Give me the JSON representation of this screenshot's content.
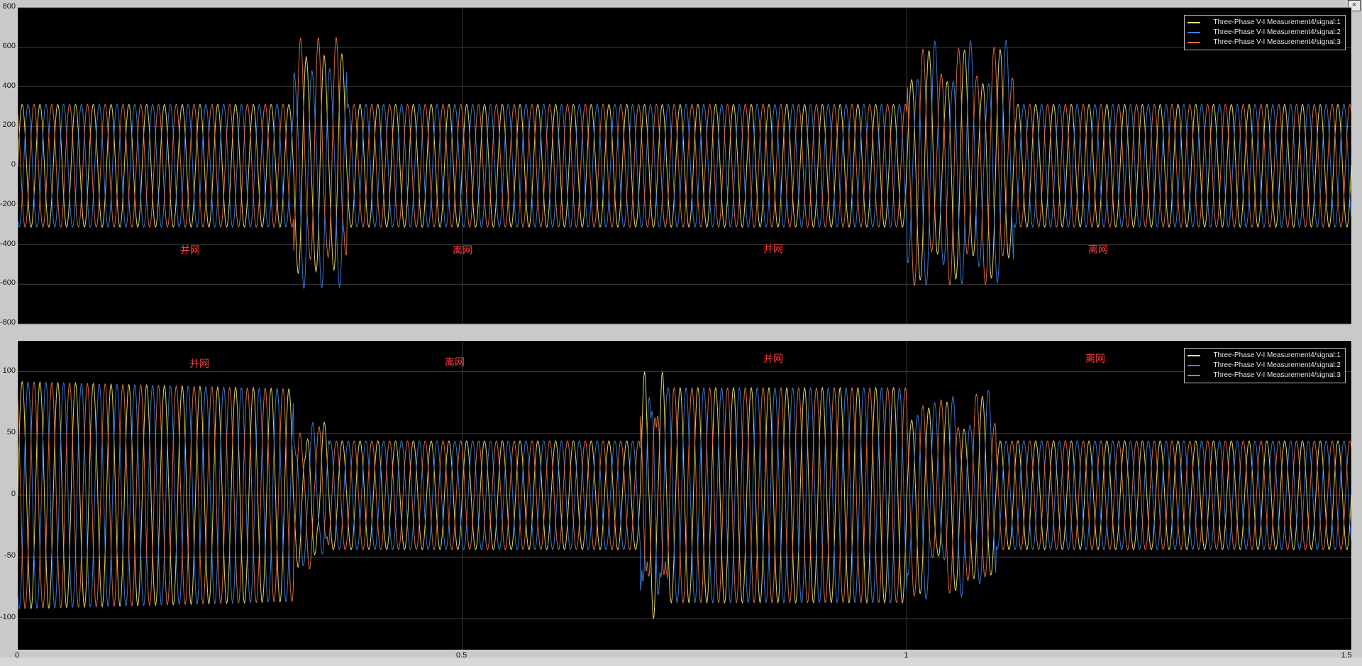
{
  "window": {
    "close_glyph": "×"
  },
  "colors": {
    "signal1": "#f2e36a",
    "signal2": "#3c7fe0",
    "signal3": "#e7723f",
    "annotation": "#ff3b3b",
    "grid": "#3f3f3f",
    "background": "#000000"
  },
  "legend_entries": [
    "Three-Phase V-I Measurement4/signal:1",
    "Three-Phase V-I Measurement4/signal:2",
    "Three-Phase V-I Measurement4/signal:3"
  ],
  "annotations_top": [
    "并网",
    "离网",
    "并网",
    "离网"
  ],
  "annotations_bottom": [
    "并网",
    "离网",
    "并网",
    "离网"
  ],
  "chart_data": [
    {
      "type": "line",
      "title": "",
      "xlabel": "",
      "ylabel": "",
      "xlim": [
        0,
        1.5
      ],
      "ylim": [
        -800,
        800
      ],
      "y_ticks": [
        "800",
        "600",
        "400",
        "200",
        "0",
        "-200",
        "-400",
        "-600",
        "-800"
      ],
      "x_ticks": [],
      "grid": true,
      "legend": "top-right",
      "series": [
        {
          "name": "Three-Phase V-I Measurement4/signal:1",
          "frequency_hz": 50,
          "phase_deg": 0,
          "segments": [
            {
              "from": 0,
              "to": 0.31,
              "amplitude": 311
            },
            {
              "from": 0.31,
              "to": 0.37,
              "amplitude": 620,
              "transient": true
            },
            {
              "from": 0.37,
              "to": 1.0,
              "amplitude": 311
            },
            {
              "from": 1.0,
              "to": 1.12,
              "amplitude": 600,
              "transient": true
            },
            {
              "from": 1.12,
              "to": 1.5,
              "amplitude": 311
            }
          ]
        },
        {
          "name": "Three-Phase V-I Measurement4/signal:2",
          "frequency_hz": 50,
          "phase_deg": -120,
          "segments": [
            {
              "from": 0,
              "to": 0.31,
              "amplitude": 311
            },
            {
              "from": 0.31,
              "to": 0.37,
              "amplitude": 640,
              "transient": true
            },
            {
              "from": 0.37,
              "to": 1.0,
              "amplitude": 311
            },
            {
              "from": 1.0,
              "to": 1.12,
              "amplitude": 640,
              "transient": true
            },
            {
              "from": 1.12,
              "to": 1.5,
              "amplitude": 311
            }
          ]
        },
        {
          "name": "Three-Phase V-I Measurement4/signal:3",
          "frequency_hz": 50,
          "phase_deg": 120,
          "segments": [
            {
              "from": 0,
              "to": 0.31,
              "amplitude": 311
            },
            {
              "from": 0.31,
              "to": 0.37,
              "amplitude": 660,
              "transient": true
            },
            {
              "from": 0.37,
              "to": 1.0,
              "amplitude": 311
            },
            {
              "from": 1.0,
              "to": 1.12,
              "amplitude": 620,
              "transient": true
            },
            {
              "from": 1.12,
              "to": 1.5,
              "amplitude": 311
            }
          ]
        }
      ]
    },
    {
      "type": "line",
      "title": "",
      "xlabel": "",
      "ylabel": "",
      "xlim": [
        0,
        1.5
      ],
      "ylim": [
        -125,
        125
      ],
      "y_ticks": [
        "100",
        "50",
        "0",
        "-50",
        "-100"
      ],
      "x_ticks": [
        "0",
        "0.5",
        "1",
        "1.5"
      ],
      "grid": true,
      "legend": "top-right",
      "series": [
        {
          "name": "Three-Phase V-I Measurement4/signal:1",
          "frequency_hz": 50,
          "phase_deg": 0,
          "segments": [
            {
              "from": 0,
              "to": 0.31,
              "amplitude": 92,
              "end_amplitude": 86
            },
            {
              "from": 0.31,
              "to": 0.35,
              "amplitude": 60,
              "transient": true
            },
            {
              "from": 0.35,
              "to": 0.7,
              "amplitude": 44
            },
            {
              "from": 0.7,
              "to": 0.73,
              "amplitude": 100,
              "transient": true
            },
            {
              "from": 0.73,
              "to": 1.0,
              "amplitude": 87
            },
            {
              "from": 1.0,
              "to": 1.1,
              "amplitude": 80,
              "transient": true
            },
            {
              "from": 1.1,
              "to": 1.5,
              "amplitude": 44
            }
          ]
        },
        {
          "name": "Three-Phase V-I Measurement4/signal:2",
          "frequency_hz": 50,
          "phase_deg": -120,
          "segments": [
            {
              "from": 0,
              "to": 0.31,
              "amplitude": 92,
              "end_amplitude": 86
            },
            {
              "from": 0.31,
              "to": 0.35,
              "amplitude": 60,
              "transient": true
            },
            {
              "from": 0.35,
              "to": 0.7,
              "amplitude": 44
            },
            {
              "from": 0.7,
              "to": 0.73,
              "amplitude": 110,
              "transient": true
            },
            {
              "from": 0.73,
              "to": 1.0,
              "amplitude": 87
            },
            {
              "from": 1.0,
              "to": 1.1,
              "amplitude": 85,
              "transient": true
            },
            {
              "from": 1.1,
              "to": 1.5,
              "amplitude": 44
            }
          ]
        },
        {
          "name": "Three-Phase V-I Measurement4/signal:3",
          "frequency_hz": 50,
          "phase_deg": 120,
          "segments": [
            {
              "from": 0,
              "to": 0.31,
              "amplitude": 92,
              "end_amplitude": 86
            },
            {
              "from": 0.31,
              "to": 0.35,
              "amplitude": 60,
              "transient": true
            },
            {
              "from": 0.35,
              "to": 0.7,
              "amplitude": 44
            },
            {
              "from": 0.7,
              "to": 0.73,
              "amplitude": 95,
              "transient": true
            },
            {
              "from": 0.73,
              "to": 1.0,
              "amplitude": 87
            },
            {
              "from": 1.0,
              "to": 1.1,
              "amplitude": 82,
              "transient": true
            },
            {
              "from": 1.1,
              "to": 1.5,
              "amplitude": 44
            }
          ]
        }
      ]
    }
  ]
}
